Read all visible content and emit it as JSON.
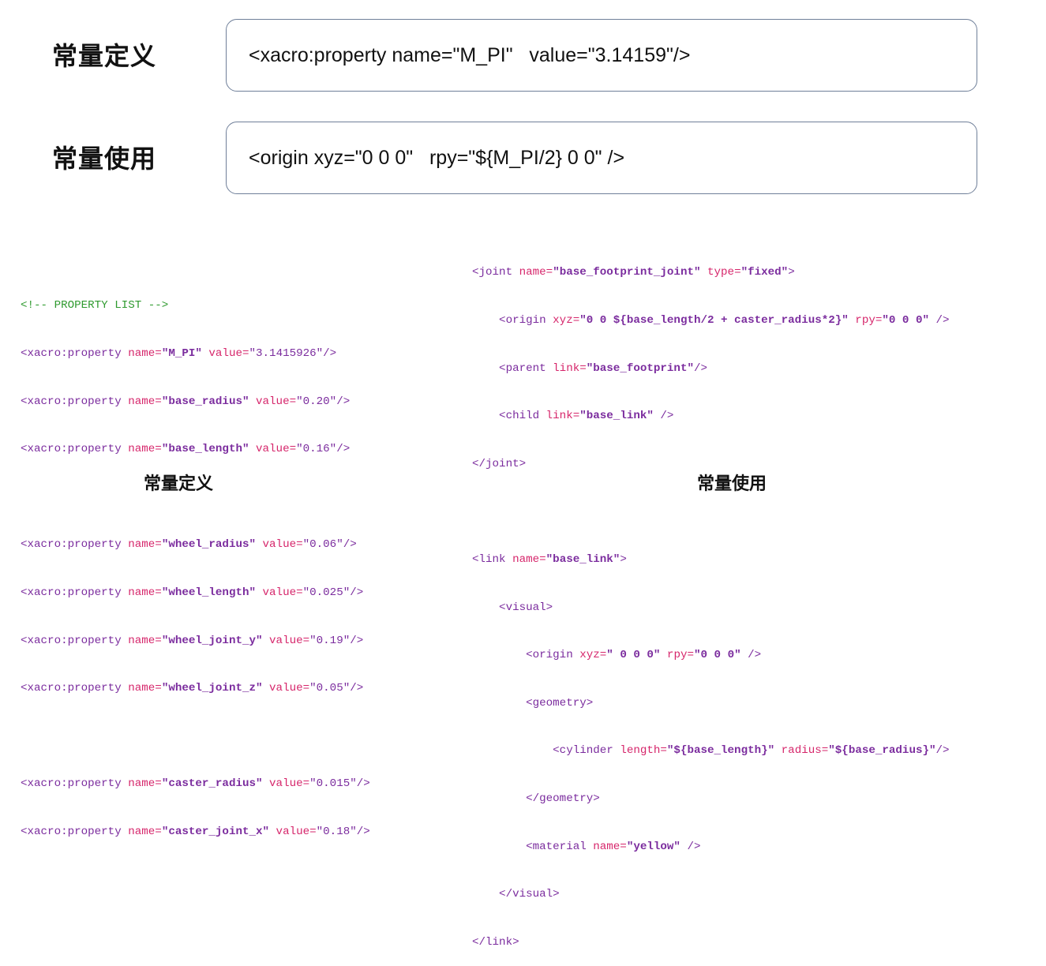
{
  "top": {
    "definition_label": "常量定义",
    "definition_code": "<xacro:property name=\"M_PI\"   value=\"3.14159\"/>",
    "usage_label": "常量使用",
    "usage_code": "<origin xyz=\"0 0 0\"   rpy=\"${M_PI/2} 0 0\" />"
  },
  "left_code": {
    "comment": "<!-- PROPERTY LIST -->",
    "properties": [
      {
        "open": "<xacro:property ",
        "name_attr": "name=",
        "name": "\"M_PI\"",
        "value_attr": " value=",
        "value": "\"3.1415926\"",
        "close": "/>"
      },
      {
        "open": "<xacro:property ",
        "name_attr": "name=",
        "name": "\"base_radius\"",
        "value_attr": " value=",
        "value": "\"0.20\"",
        "close": "/>"
      },
      {
        "open": "<xacro:property ",
        "name_attr": "name=",
        "name": "\"base_length\"",
        "value_attr": " value=",
        "value": "\"0.16\"",
        "close": "/>"
      },
      {
        "open": "<xacro:property ",
        "name_attr": "name=",
        "name": "\"wheel_radius\"",
        "value_attr": " value=",
        "value": "\"0.06\"",
        "close": "/>"
      },
      {
        "open": "<xacro:property ",
        "name_attr": "name=",
        "name": "\"wheel_length\"",
        "value_attr": " value=",
        "value": "\"0.025\"",
        "close": "/>"
      },
      {
        "open": "<xacro:property ",
        "name_attr": "name=",
        "name": "\"wheel_joint_y\"",
        "value_attr": " value=",
        "value": "\"0.19\"",
        "close": "/>"
      },
      {
        "open": "<xacro:property ",
        "name_attr": "name=",
        "name": "\"wheel_joint_z\"",
        "value_attr": " value=",
        "value": "\"0.05\"",
        "close": "/>"
      },
      {
        "open": "<xacro:property ",
        "name_attr": "name=",
        "name": "\"caster_radius\"",
        "value_attr": " value=",
        "value": "\"0.015\"",
        "close": "/>"
      },
      {
        "open": "<xacro:property ",
        "name_attr": "name=",
        "name": "\"caster_joint_x\"",
        "value_attr": " value=",
        "value": "\"0.18\"",
        "close": "/>"
      }
    ],
    "caption": "常量定义"
  },
  "right_code": {
    "l1_tag": "<joint ",
    "l1_a1": "name=",
    "l1_v1": "\"base_footprint_joint\"",
    "l1_a2": " type=",
    "l1_v2": "\"fixed\"",
    "l1_end": ">",
    "l2_tag": "    <origin ",
    "l2_a1": "xyz=",
    "l2_v1": "\"0 0 ${base_length/2 + caster_radius*2}\"",
    "l2_a2": " rpy=",
    "l2_v2": "\"0 0 0\"",
    "l2_end": " />",
    "l3_tag": "    <parent ",
    "l3_a1": "link=",
    "l3_v1": "\"base_footprint\"",
    "l3_end": "/>",
    "l4_tag": "    <child ",
    "l4_a1": "link=",
    "l4_v1": "\"base_link\"",
    "l4_end": " />",
    "l5": "</joint>",
    "l7_tag": "<link ",
    "l7_a1": "name=",
    "l7_v1": "\"base_link\"",
    "l7_end": ">",
    "l8": "    <visual>",
    "l9_tag": "        <origin ",
    "l9_a1": "xyz=",
    "l9_v1": "\" 0 0 0\"",
    "l9_a2": " rpy=",
    "l9_v2": "\"0 0 0\"",
    "l9_end": " />",
    "l10": "        <geometry>",
    "l11_tag": "            <cylinder ",
    "l11_a1": "length=",
    "l11_v1": "\"${base_length}\"",
    "l11_a2": " radius=",
    "l11_v2": "\"${base_radius}\"",
    "l11_end": "/>",
    "l12": "        </geometry>",
    "l13_tag": "        <material ",
    "l13_a1": "name=",
    "l13_v1": "\"yellow\"",
    "l13_end": " />",
    "l14": "    </visual>",
    "l15": "</link>",
    "caption": "常量使用"
  }
}
